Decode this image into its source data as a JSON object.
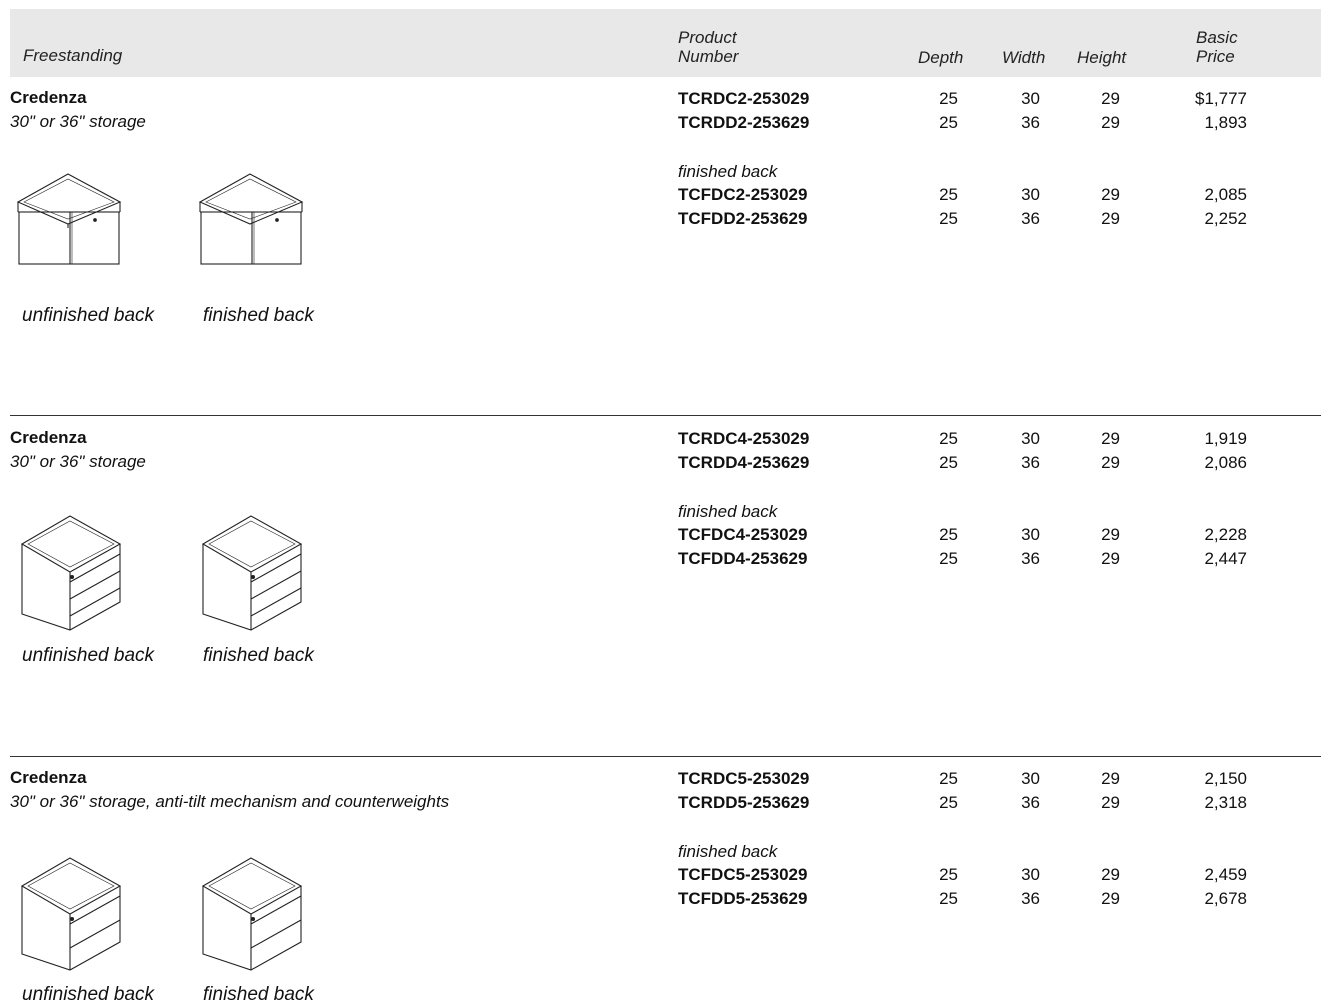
{
  "header": {
    "category": "Freestanding",
    "product_number_line1": "Product",
    "product_number_line2": "Number",
    "depth": "Depth",
    "width": "Width",
    "height": "Height",
    "price_line1": "Basic",
    "price_line2": "Price"
  },
  "sections": [
    {
      "title": "Credenza",
      "subtitle": "30\" or 36\" storage",
      "caption_unfinished": "unfinished back",
      "caption_finished": "finished back",
      "finished_label": "finished back",
      "illustration": "credenza-two-door-icon",
      "rows": [
        {
          "product": "TCRDC2-253029",
          "depth": "25",
          "width": "30",
          "height": "29",
          "price": "$1,777"
        },
        {
          "product": "TCRDD2-253629",
          "depth": "25",
          "width": "36",
          "height": "29",
          "price": "1,893"
        }
      ],
      "finished_rows": [
        {
          "product": "TCFDC2-253029",
          "depth": "25",
          "width": "30",
          "height": "29",
          "price": "2,085"
        },
        {
          "product": "TCFDD2-253629",
          "depth": "25",
          "width": "36",
          "height": "29",
          "price": "2,252"
        }
      ]
    },
    {
      "title": "Credenza",
      "subtitle": "30\" or 36\" storage",
      "caption_unfinished": "unfinished back",
      "caption_finished": "finished back",
      "finished_label": "finished back",
      "illustration": "credenza-three-drawer-icon",
      "rows": [
        {
          "product": "TCRDC4-253029",
          "depth": "25",
          "width": "30",
          "height": "29",
          "price": "1,919"
        },
        {
          "product": "TCRDD4-253629",
          "depth": "25",
          "width": "36",
          "height": "29",
          "price": "2,086"
        }
      ],
      "finished_rows": [
        {
          "product": "TCFDC4-253029",
          "depth": "25",
          "width": "30",
          "height": "29",
          "price": "2,228"
        },
        {
          "product": "TCFDD4-253629",
          "depth": "25",
          "width": "36",
          "height": "29",
          "price": "2,447"
        }
      ]
    },
    {
      "title": "Credenza",
      "subtitle": "30\" or 36\" storage, anti-tilt mechanism and counterweights",
      "caption_unfinished": "unfinished back",
      "caption_finished": "finished back",
      "finished_label": "finished back",
      "illustration": "credenza-two-drawer-icon",
      "rows": [
        {
          "product": "TCRDC5-253029",
          "depth": "25",
          "width": "30",
          "height": "29",
          "price": "2,150"
        },
        {
          "product": "TCRDD5-253629",
          "depth": "25",
          "width": "36",
          "height": "29",
          "price": "2,318"
        }
      ],
      "finished_rows": [
        {
          "product": "TCFDC5-253029",
          "depth": "25",
          "width": "30",
          "height": "29",
          "price": "2,459"
        },
        {
          "product": "TCFDD5-253629",
          "depth": "25",
          "width": "36",
          "height": "29",
          "price": "2,678"
        }
      ]
    }
  ]
}
